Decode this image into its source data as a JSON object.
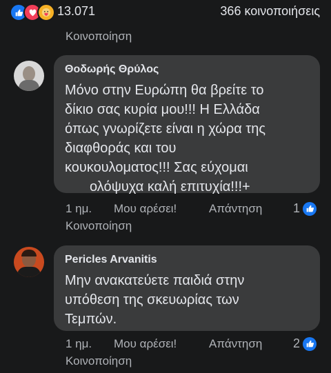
{
  "post": {
    "reaction_count": "13.071",
    "shares": "366 κοινοποιήσεις",
    "share_label": "Κοινοποίηση",
    "reaction_icons": [
      "like-icon",
      "love-icon",
      "care-icon"
    ]
  },
  "comments": [
    {
      "author": "Θοδωρής Θρύλος",
      "lines": [
        "Μόνο στην Ευρώπη θα βρείτε το",
        "δίκιο σας κυρία μου!!! Η Ελλάδα",
        "όπως γνωρίζετε είναι η χώρα της",
        "διαφθοράς και του",
        "κουκουλοματος!!! Σας εύχομαι",
        "ολόψυχα καλή επιτυχία!!!+"
      ],
      "time": "1 ημ.",
      "like": "Μου αρέσει!",
      "reply": "Απάντηση",
      "share": "Κοινοποίηση",
      "likes": "1"
    },
    {
      "author": "Pericles Arvanitis",
      "lines": [
        "Μην ανακατεύετε παιδιά στην",
        "υπόθεση της σκευωρίας των",
        "Τεμπών."
      ],
      "time": "1 ημ.",
      "like": "Μου αρέσει!",
      "reply": "Απάντηση",
      "share": "Κοινοποίηση",
      "likes": "2"
    }
  ],
  "colors": {
    "background": "#18191a",
    "bubble": "#3a3b3c",
    "text": "#e4e6eb",
    "secondary": "#b0b3b8",
    "like_blue": "#1877f2",
    "love_red": "#f33e58",
    "care_yellow": "#f7b125"
  }
}
